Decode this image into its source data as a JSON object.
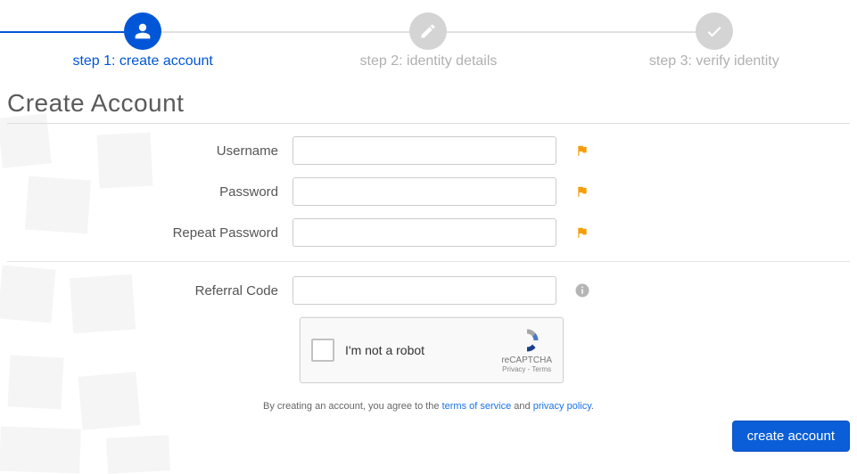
{
  "stepper": {
    "steps": [
      {
        "label": "step 1: create account",
        "icon": "user-icon",
        "active": true
      },
      {
        "label": "step 2: identity details",
        "icon": "pencil-icon",
        "active": false
      },
      {
        "label": "step 3: verify identity",
        "icon": "check-icon",
        "active": false
      }
    ]
  },
  "title": "Create Account",
  "form": {
    "username": {
      "label": "Username",
      "value": ""
    },
    "password": {
      "label": "Password",
      "value": ""
    },
    "repeat_password": {
      "label": "Repeat Password",
      "value": ""
    },
    "referral_code": {
      "label": "Referral Code",
      "value": ""
    }
  },
  "recaptcha": {
    "text": "I'm not a robot",
    "brand": "reCAPTCHA",
    "links": "Privacy - Terms"
  },
  "consent": {
    "prefix": "By creating an account, you agree to the ",
    "tos": "terms of service",
    "mid": " and ",
    "privacy": "privacy policy",
    "suffix": "."
  },
  "actions": {
    "submit_label": "create account"
  }
}
